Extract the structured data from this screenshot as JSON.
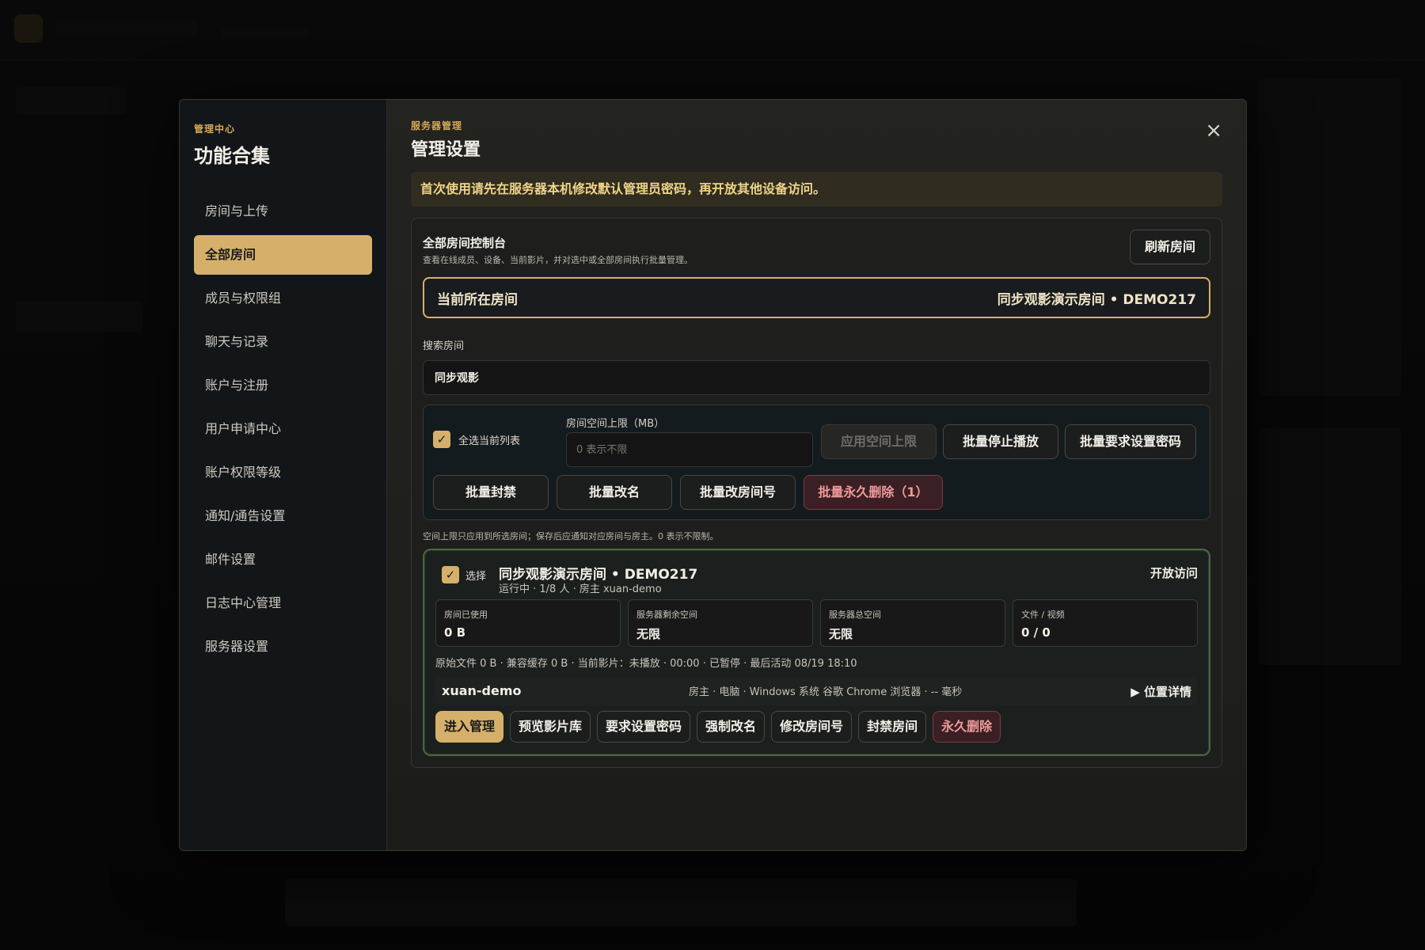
{
  "sidebar": {
    "kicker": "管理中心",
    "title": "功能合集",
    "items": [
      {
        "label": "房间与上传"
      },
      {
        "label": "全部房间",
        "active": true
      },
      {
        "label": "成员与权限组"
      },
      {
        "label": "聊天与记录"
      },
      {
        "label": "账户与注册"
      },
      {
        "label": "用户申请中心"
      },
      {
        "label": "账户权限等级"
      },
      {
        "label": "通知/通告设置"
      },
      {
        "label": "邮件设置"
      },
      {
        "label": "日志中心管理"
      },
      {
        "label": "服务器设置"
      }
    ]
  },
  "main": {
    "kicker": "服务器管理",
    "title": "管理设置",
    "close_icon": "×",
    "notice": "首次使用请先在服务器本机修改默认管理员密码，再开放其他设备访问。"
  },
  "panel": {
    "title": "全部房间控制台",
    "subtitle": "查看在线成员、设备、当前影片，并对选中或全部房间执行批量管理。",
    "refresh_label": "刷新房间",
    "current_room_label": "当前所在房间",
    "current_room_value": "同步观影演示房间 • DEMO217",
    "search_label": "搜索房间",
    "search_value": "同步观影"
  },
  "batch": {
    "select_all_label": "全选当前列表",
    "quota_label": "房间空间上限（MB）",
    "quota_placeholder": "0 表示不限",
    "apply_quota": "应用空间上限",
    "stop_play": "批量停止播放",
    "require_password": "批量要求设置密码",
    "ban": "批量封禁",
    "rename": "批量改名",
    "change_number": "批量改房间号",
    "delete": "批量永久删除（1）",
    "hint": "空间上限只应用到所选房间；保存后应通知对应房间与房主。0 表示不限制。"
  },
  "room": {
    "select_label": "选择",
    "name": "同步观影演示房间 • DEMO217",
    "meta": "运行中 · 1/8 人 · 房主 xuan-demo",
    "access": "开放访问",
    "stats": [
      {
        "label": "房间已使用",
        "value": "0 B"
      },
      {
        "label": "服务器剩余空间",
        "value": "无限"
      },
      {
        "label": "服务器总空间",
        "value": "无限"
      },
      {
        "label": "文件 / 视频",
        "value": "0 / 0"
      }
    ],
    "details": "原始文件 0 B · 兼容缓存 0 B · 当前影片：未播放 · 00:00 · 已暂停 · 最后活动 08/19 18:10",
    "member_name": "xuan-demo",
    "member_info": "房主 · 电脑 · Windows 系统 谷歌 Chrome 浏览器 · -- 毫秒",
    "location_label": "▶ 位置详情",
    "actions": {
      "enter": "进入管理",
      "preview": "预览影片库",
      "require_password": "要求设置密码",
      "force_rename": "强制改名",
      "change_number": "修改房间号",
      "ban": "封禁房间",
      "delete": "永久删除"
    }
  },
  "colors": {
    "accent": "#d6b06a",
    "danger": "#f09a9a",
    "notice_text": "#f0d589"
  }
}
